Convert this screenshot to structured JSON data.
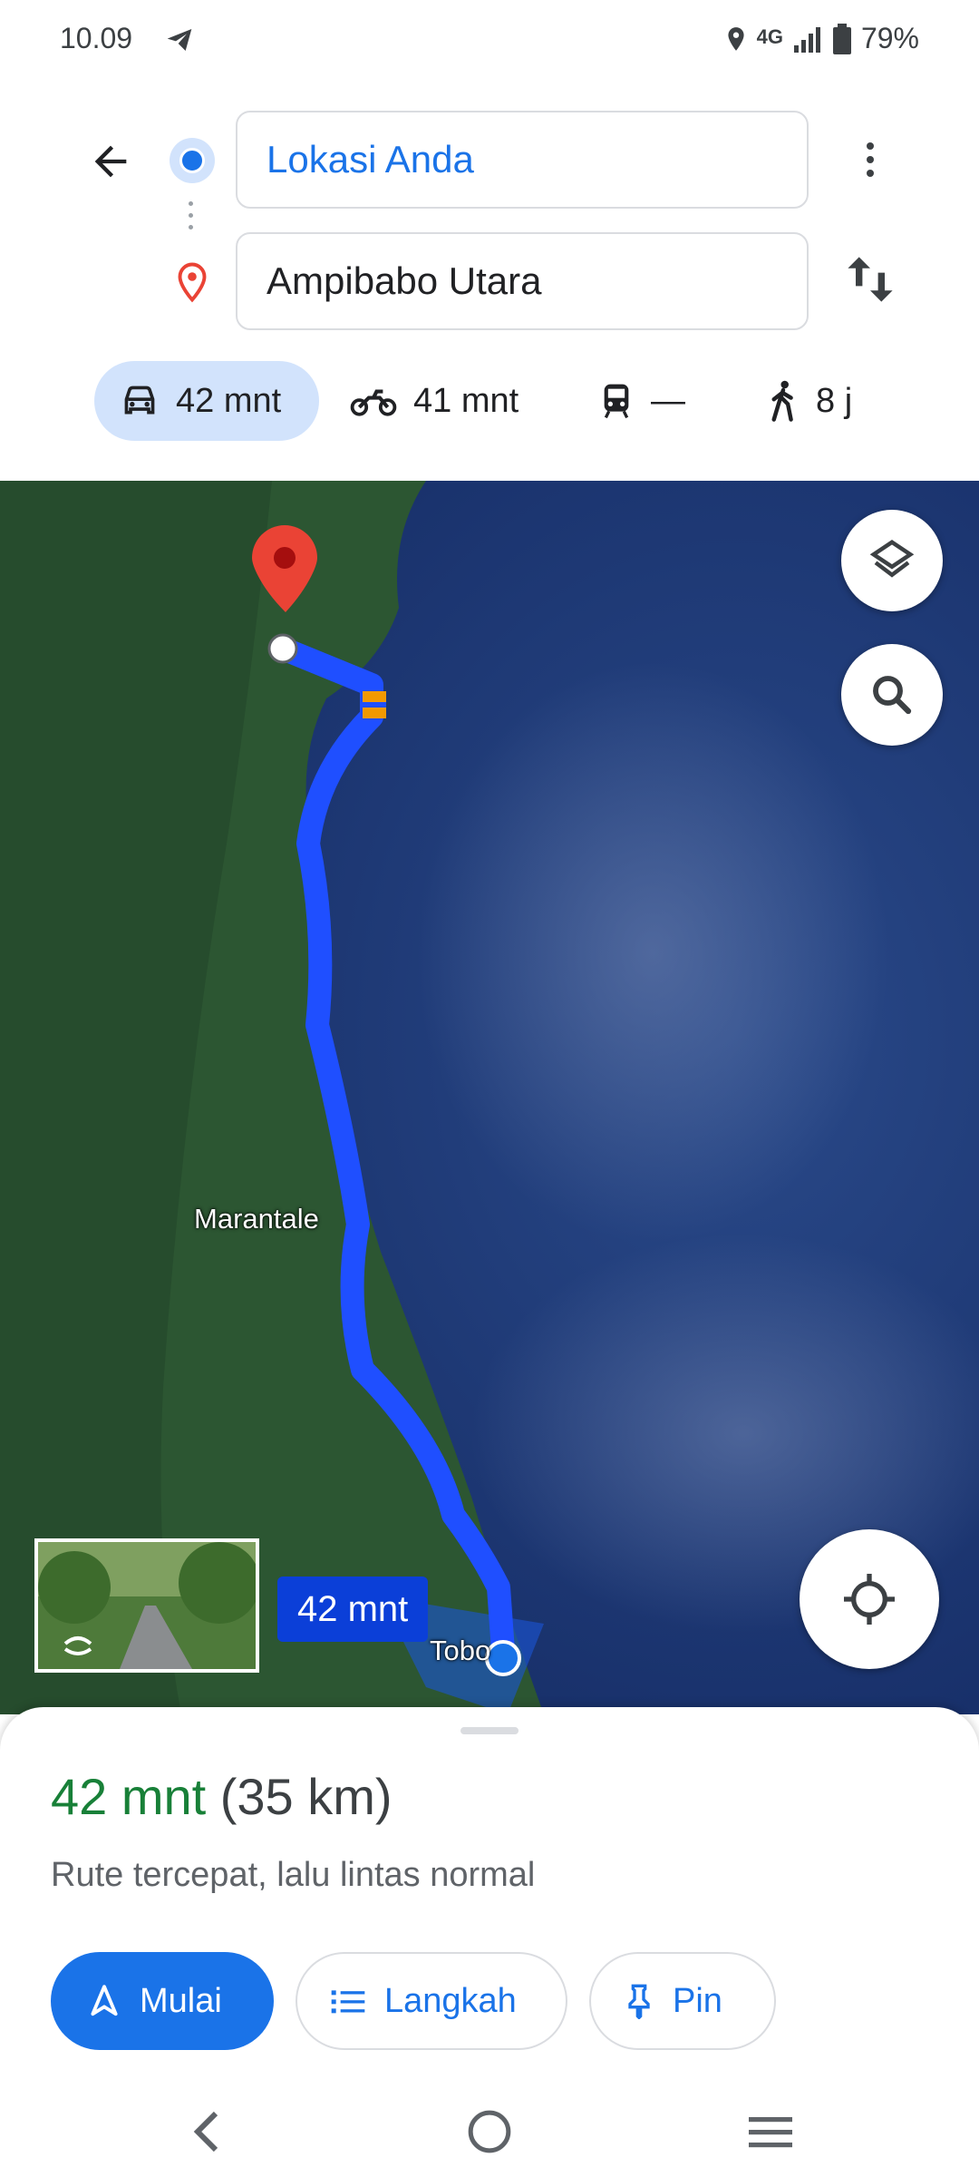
{
  "status_bar": {
    "time": "10.09",
    "network": "4G",
    "battery": "79%",
    "icons": [
      "telegram-icon",
      "location-icon",
      "signal-icon",
      "battery-icon"
    ]
  },
  "search": {
    "origin": "Lokasi Anda",
    "destination": "Ampibabo Utara"
  },
  "modes": [
    {
      "icon": "car-icon",
      "label": "42 mnt",
      "selected": true
    },
    {
      "icon": "motorcycle-icon",
      "label": "41 mnt",
      "selected": false
    },
    {
      "icon": "transit-icon",
      "label": "—",
      "selected": false
    },
    {
      "icon": "walk-icon",
      "label": "8 j",
      "selected": false
    }
  ],
  "map": {
    "labels": {
      "town1": "Marantale",
      "town2": "Tobo"
    },
    "eta_label": "42 mnt",
    "colors": {
      "route": "#1f4fff",
      "water": "#1e3a78",
      "land": "#2e5a32",
      "pin": "#ea4335"
    }
  },
  "sheet": {
    "time": "42 mnt",
    "distance": "(35 km)",
    "description": "Rute tercepat, lalu lintas normal",
    "buttons": {
      "start": "Mulai",
      "steps": "Langkah",
      "pin": "Pin"
    }
  },
  "colors": {
    "accent": "#1a73e8",
    "time_green": "#188038",
    "selected_chip": "#d2e3fc"
  }
}
